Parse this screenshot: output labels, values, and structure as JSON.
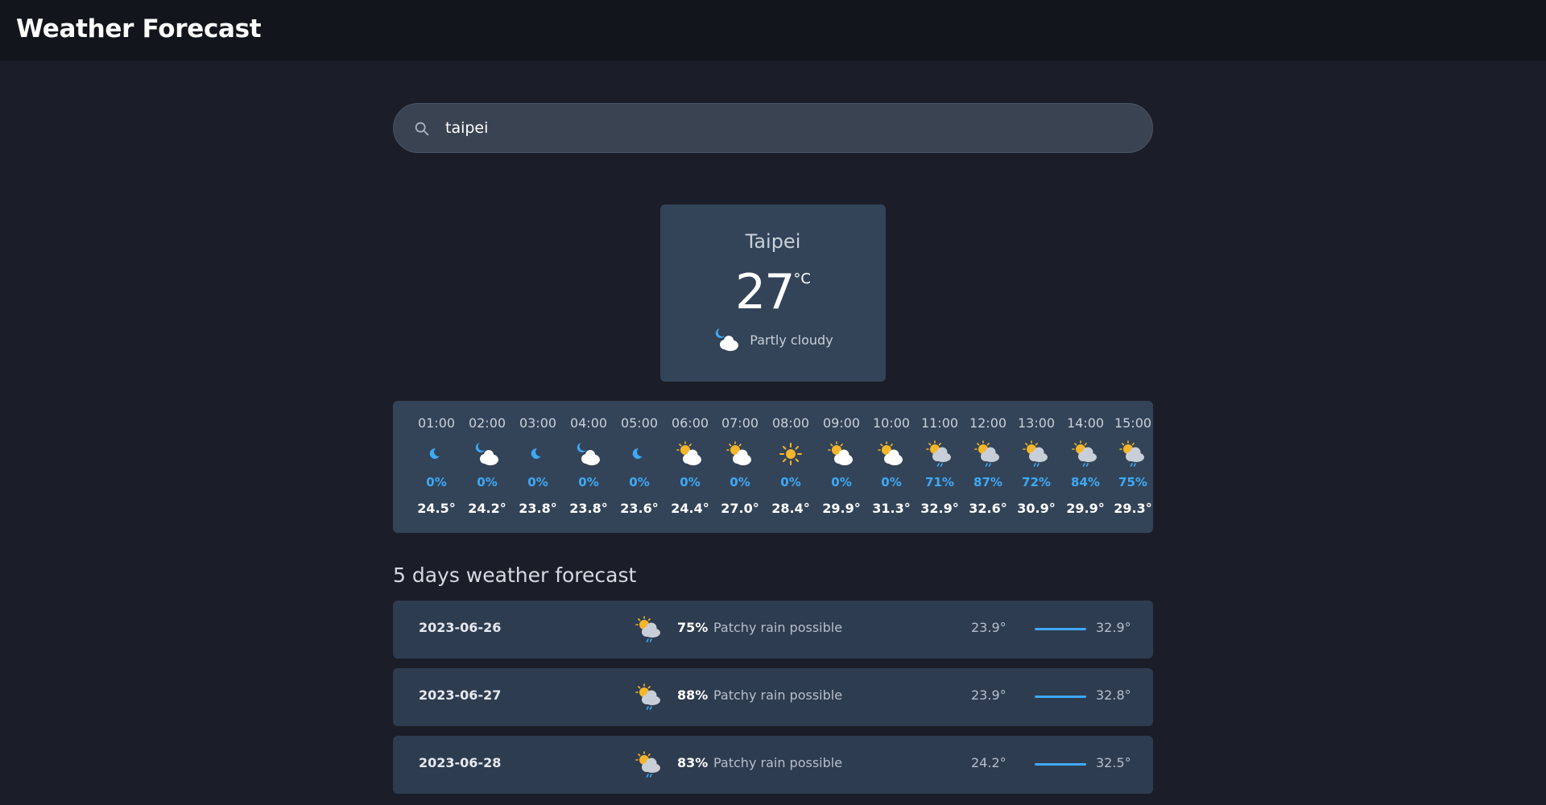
{
  "header": {
    "title": "Weather Forecast"
  },
  "search": {
    "value": "taipei",
    "icon": "search-icon"
  },
  "current": {
    "city": "Taipei",
    "temp": "27",
    "unit": "°C",
    "condition": "Partly cloudy",
    "icon": "moon-cloud-icon"
  },
  "hourly": [
    {
      "time": "01:00",
      "icon": "moon-icon",
      "pop": "0%",
      "temp": "24.5°"
    },
    {
      "time": "02:00",
      "icon": "moon-cloud-icon",
      "pop": "0%",
      "temp": "24.2°"
    },
    {
      "time": "03:00",
      "icon": "moon-icon",
      "pop": "0%",
      "temp": "23.8°"
    },
    {
      "time": "04:00",
      "icon": "moon-cloud-icon",
      "pop": "0%",
      "temp": "23.8°"
    },
    {
      "time": "05:00",
      "icon": "moon-icon",
      "pop": "0%",
      "temp": "23.6°"
    },
    {
      "time": "06:00",
      "icon": "sun-cloud-icon",
      "pop": "0%",
      "temp": "24.4°"
    },
    {
      "time": "07:00",
      "icon": "sun-cloud-icon",
      "pop": "0%",
      "temp": "27.0°"
    },
    {
      "time": "08:00",
      "icon": "sun-icon",
      "pop": "0%",
      "temp": "28.4°"
    },
    {
      "time": "09:00",
      "icon": "sun-cloud-icon",
      "pop": "0%",
      "temp": "29.9°"
    },
    {
      "time": "10:00",
      "icon": "sun-cloud-icon",
      "pop": "0%",
      "temp": "31.3°"
    },
    {
      "time": "11:00",
      "icon": "sun-rain-icon",
      "pop": "71%",
      "temp": "32.9°"
    },
    {
      "time": "12:00",
      "icon": "sun-rain-icon",
      "pop": "87%",
      "temp": "32.6°"
    },
    {
      "time": "13:00",
      "icon": "sun-rain-icon",
      "pop": "72%",
      "temp": "30.9°"
    },
    {
      "time": "14:00",
      "icon": "sun-rain-icon",
      "pop": "84%",
      "temp": "29.9°"
    },
    {
      "time": "15:00",
      "icon": "sun-rain-icon",
      "pop": "75%",
      "temp": "29.3°"
    }
  ],
  "forecast": {
    "title": "5 days weather forecast",
    "days": [
      {
        "date": "2023-06-26",
        "icon": "sun-rain-icon",
        "pop": "75%",
        "condition": "Patchy rain possible",
        "min": "23.9°",
        "max": "32.9°"
      },
      {
        "date": "2023-06-27",
        "icon": "sun-rain-icon",
        "pop": "88%",
        "condition": "Patchy rain possible",
        "min": "23.9°",
        "max": "32.8°"
      },
      {
        "date": "2023-06-28",
        "icon": "sun-rain-icon",
        "pop": "83%",
        "condition": "Patchy rain possible",
        "min": "24.2°",
        "max": "32.5°"
      }
    ]
  },
  "colors": {
    "accent": "#3fa9f5",
    "card": "#334458",
    "background": "#1b1e28"
  }
}
